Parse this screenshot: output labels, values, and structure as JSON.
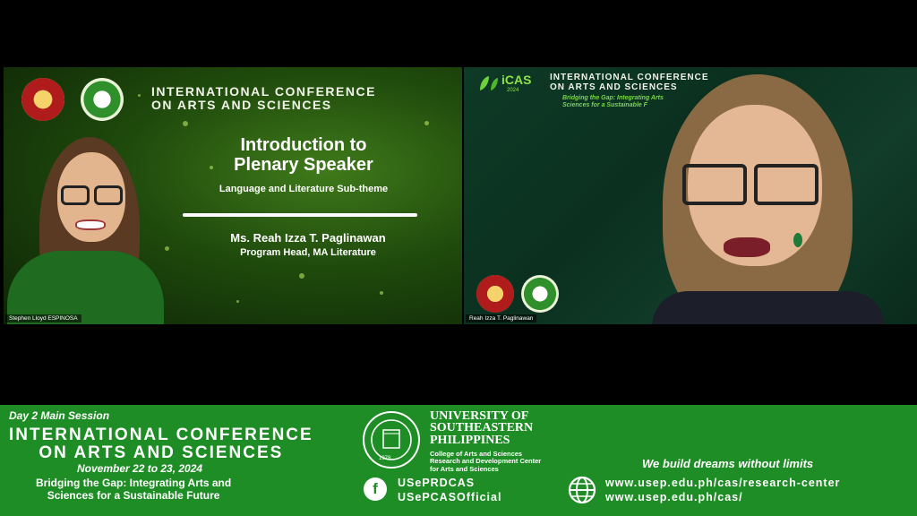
{
  "left_tile": {
    "conference_title_line1": "INTERNATIONAL CONFERENCE",
    "conference_title_line2": "ON ARTS AND SCIENCES",
    "heading_line1": "Introduction to",
    "heading_line2": "Plenary Speaker",
    "subtheme": "Language and Literature Sub-theme",
    "speaker_name": "Ms. Reah Izza T. Paglinawan",
    "speaker_role": "Program Head, MA Literature",
    "participant_name": "Stephen Lloyd ESPINOSA"
  },
  "right_tile": {
    "logo_text": "iCAS",
    "logo_year": "2024",
    "conference_title_line1": "INTERNATIONAL CONFERENCE",
    "conference_title_line2": "ON ARTS AND SCIENCES",
    "theme_line1": "Bridging the Gap: Integrating Arts",
    "theme_line2": "Sciences for a Sustainable F",
    "participant_name": "Reah Izza T. Paglinawan"
  },
  "footer": {
    "session": "Day 2 Main Session",
    "title_line1": "INTERNATIONAL CONFERENCE",
    "title_line2": "ON ARTS AND SCIENCES",
    "dates": "November 22 to 23, 2024",
    "theme_line1": "Bridging the Gap: Integrating Arts and",
    "theme_line2": "Sciences for a Sustainable Future",
    "university_line1": "UNIVERSITY OF",
    "university_line2": "SOUTHEASTERN",
    "university_line3": "PHILIPPINES",
    "college_line1": "College of Arts and Sciences",
    "college_line2": "Research and Development Center",
    "college_line3": "for Arts and Sciences",
    "seal_year": "1978",
    "facebook_icon_glyph": "f",
    "facebook_page1": "USePRDCAS",
    "facebook_page2": "USePCASOfficial",
    "tagline": "We build dreams without limits",
    "website1": "www.usep.edu.ph/cas/research-center",
    "website2": "www.usep.edu.ph/cas/"
  },
  "colors": {
    "footer_green": "#1f8d25",
    "background": "#000000"
  }
}
